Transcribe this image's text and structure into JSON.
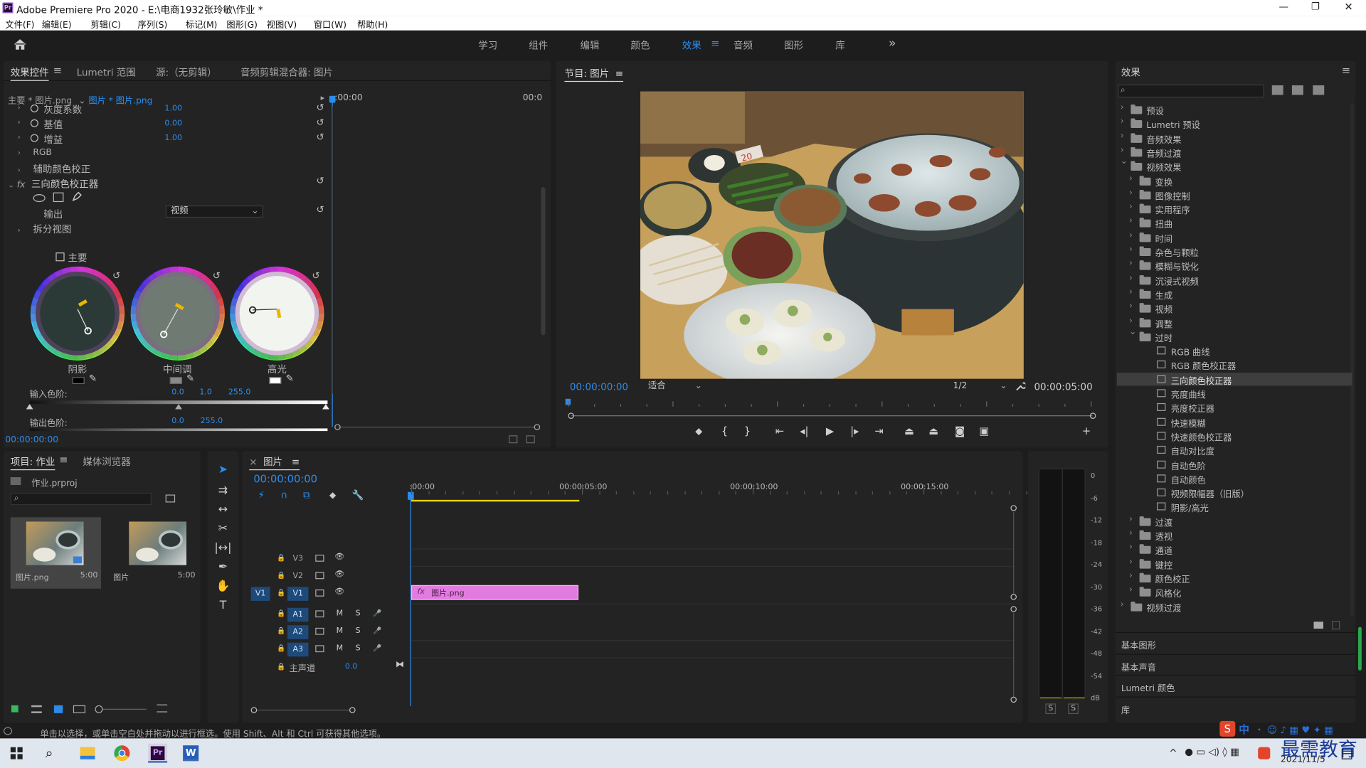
{
  "titlebar": {
    "title": "Adobe Premiere Pro 2020 - E:\\电商1932张玲敏\\作业 *",
    "app_icon_text": "Pr",
    "minimize": "—",
    "maximize": "❐",
    "close": "✕"
  },
  "menu": [
    "文件(F)",
    "编辑(E)",
    "剪辑(C)",
    "序列(S)",
    "标记(M)",
    "图形(G)",
    "视图(V)",
    "窗口(W)",
    "帮助(H)"
  ],
  "workspaces": [
    "学习",
    "组件",
    "编辑",
    "颜色",
    "效果",
    "音频",
    "图形",
    "库"
  ],
  "workspace_active": "效果",
  "workspace_more": "»",
  "effect_controls": {
    "tabs": [
      "效果控件",
      "Lumetri 范围",
      "源:（无剪辑）",
      "音频剪辑混合器: 图片"
    ],
    "clip_master": "主要 * 图片.png",
    "clip_seq": "图片 * 图片.png",
    "time_start": ":00:00",
    "time_end": "00:0",
    "params": [
      {
        "label": "灰度系数",
        "value": "1.00"
      },
      {
        "label": "基值",
        "value": "0.00"
      },
      {
        "label": "增益",
        "value": "1.00"
      }
    ],
    "rgb": "RGB",
    "aux": "辅助颜色校正",
    "fx_label": "fx",
    "effect_name": "三向颜色校正器",
    "output_label": "输出",
    "output_value": "视频",
    "split_view": "拆分视图",
    "master_label": "主要",
    "wheels": [
      "阴影",
      "中间调",
      "高光"
    ],
    "input_levels_label": "输入色阶:",
    "input_levels": [
      "0.0",
      "1.0",
      "255.0"
    ],
    "output_levels_label": "输出色阶:",
    "output_levels": [
      "0.0",
      "255.0"
    ],
    "timecode": "00:00:00:00"
  },
  "program": {
    "title": "节目: 图片",
    "timecode": "00:00:00:00",
    "fit": "适合",
    "resolution": "1/2",
    "duration": "00:00:05:00"
  },
  "project": {
    "tabs": [
      "项目: 作业",
      "媒体浏览器"
    ],
    "file": "作业.prproj",
    "items": [
      {
        "name": "图片.png",
        "duration": "5:00"
      },
      {
        "name": "图片",
        "duration": "5:00"
      }
    ]
  },
  "timeline": {
    "tab": "图片",
    "timecode": "00:00:00:00",
    "ruler": [
      ":00:00",
      "00:00:05:00",
      "00:00:10:00",
      "00:00:15:00"
    ],
    "video_tracks": [
      "V3",
      "V2",
      "V1"
    ],
    "audio_tracks": [
      "A1",
      "A2",
      "A3"
    ],
    "source_patch_v": "V1",
    "master_label": "主声道",
    "master_value": "0.0",
    "clip_label": "图片.png",
    "clip_fx": "fx",
    "m": "M",
    "s": "S"
  },
  "meter": {
    "scale": [
      "0",
      "-6",
      "-12",
      "-18",
      "-24",
      "-30",
      "-36",
      "-42",
      "-48",
      "-54",
      "dB"
    ],
    "solo": [
      "S",
      "S"
    ]
  },
  "effects_panel": {
    "title": "效果",
    "tree": [
      {
        "label": "预设",
        "depth": 0,
        "open": false,
        "type": "folder"
      },
      {
        "label": "Lumetri 预设",
        "depth": 0,
        "open": false,
        "type": "folder"
      },
      {
        "label": "音频效果",
        "depth": 0,
        "open": false,
        "type": "folder"
      },
      {
        "label": "音频过渡",
        "depth": 0,
        "open": false,
        "type": "folder"
      },
      {
        "label": "视频效果",
        "depth": 0,
        "open": true,
        "type": "folder"
      },
      {
        "label": "变换",
        "depth": 1,
        "open": false,
        "type": "folder"
      },
      {
        "label": "图像控制",
        "depth": 1,
        "open": false,
        "type": "folder"
      },
      {
        "label": "实用程序",
        "depth": 1,
        "open": false,
        "type": "folder"
      },
      {
        "label": "扭曲",
        "depth": 1,
        "open": false,
        "type": "folder"
      },
      {
        "label": "时间",
        "depth": 1,
        "open": false,
        "type": "folder"
      },
      {
        "label": "杂色与颗粒",
        "depth": 1,
        "open": false,
        "type": "folder"
      },
      {
        "label": "模糊与锐化",
        "depth": 1,
        "open": false,
        "type": "folder"
      },
      {
        "label": "沉浸式视频",
        "depth": 1,
        "open": false,
        "type": "folder"
      },
      {
        "label": "生成",
        "depth": 1,
        "open": false,
        "type": "folder"
      },
      {
        "label": "视频",
        "depth": 1,
        "open": false,
        "type": "folder"
      },
      {
        "label": "调整",
        "depth": 1,
        "open": false,
        "type": "folder"
      },
      {
        "label": "过时",
        "depth": 1,
        "open": true,
        "type": "folder"
      },
      {
        "label": "RGB 曲线",
        "depth": 2,
        "type": "effect"
      },
      {
        "label": "RGB 颜色校正器",
        "depth": 2,
        "type": "effect"
      },
      {
        "label": "三向颜色校正器",
        "depth": 2,
        "type": "effect",
        "selected": true
      },
      {
        "label": "亮度曲线",
        "depth": 2,
        "type": "effect"
      },
      {
        "label": "亮度校正器",
        "depth": 2,
        "type": "effect"
      },
      {
        "label": "快速模糊",
        "depth": 2,
        "type": "effect"
      },
      {
        "label": "快速颜色校正器",
        "depth": 2,
        "type": "effect"
      },
      {
        "label": "自动对比度",
        "depth": 2,
        "type": "effect"
      },
      {
        "label": "自动色阶",
        "depth": 2,
        "type": "effect"
      },
      {
        "label": "自动颜色",
        "depth": 2,
        "type": "effect"
      },
      {
        "label": "视频限幅器（旧版）",
        "depth": 2,
        "type": "effect"
      },
      {
        "label": "阴影/高光",
        "depth": 2,
        "type": "effect"
      },
      {
        "label": "过渡",
        "depth": 1,
        "open": false,
        "type": "folder"
      },
      {
        "label": "透视",
        "depth": 1,
        "open": false,
        "type": "folder"
      },
      {
        "label": "通道",
        "depth": 1,
        "open": false,
        "type": "folder"
      },
      {
        "label": "键控",
        "depth": 1,
        "open": false,
        "type": "folder"
      },
      {
        "label": "颜色校正",
        "depth": 1,
        "open": false,
        "type": "folder"
      },
      {
        "label": "风格化",
        "depth": 1,
        "open": false,
        "type": "folder"
      },
      {
        "label": "视频过渡",
        "depth": 0,
        "open": false,
        "type": "folder"
      }
    ],
    "sections": [
      "基本图形",
      "基本声音",
      "Lumetri 颜色",
      "库"
    ]
  },
  "status": "单击以选择，或单击空白处并拖动以进行框选。使用 Shift、Alt 和 Ctrl 可获得其他选项。",
  "taskbar": {
    "ime": "中",
    "date": "2021/11/5",
    "watermark": "最需教育",
    "pr": "Pr",
    "w": "W"
  },
  "colors": {
    "accent": "#2d8ceb",
    "clip": "#e27be0",
    "panel": "#232323",
    "bg": "#1d1d1d"
  }
}
